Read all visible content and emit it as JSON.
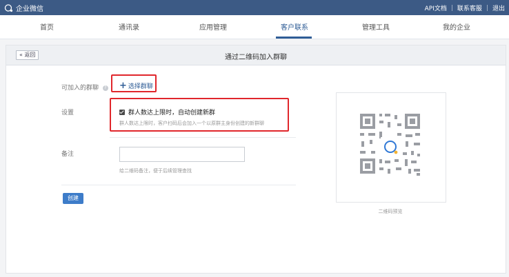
{
  "app": {
    "title": "企业微信",
    "links": [
      "API文档",
      "联系客服",
      "退出"
    ],
    "link_separator": "|"
  },
  "nav": {
    "items": [
      "首页",
      "通讯录",
      "应用管理",
      "客户联系",
      "管理工具",
      "我的企业"
    ],
    "active": "客户联系"
  },
  "page": {
    "back_label": "« 返回",
    "title": "通过二维码加入群聊"
  },
  "form": {
    "group_label": "可加入的群聊",
    "help_icon_glyph": "?",
    "select_plus": "+",
    "select_group_label": "选择群聊",
    "settings_label": "设置",
    "auto_create_label": "群人数达上限时，自动创建新群",
    "auto_create_checked": true,
    "auto_create_hint": "群人数达上限时，客户扫码后会加入一个以原群主身份创建的新群聊",
    "remark_label": "备注",
    "remark_value": "",
    "remark_hint": "给二维码备注，便于后续管理查找",
    "create_button": "创建"
  },
  "preview": {
    "caption": "二维码预览"
  },
  "colors": {
    "topbar": "#3c5a85",
    "accent": "#2f5d96",
    "highlight": "#e0262b",
    "button": "#3d7cc9"
  }
}
